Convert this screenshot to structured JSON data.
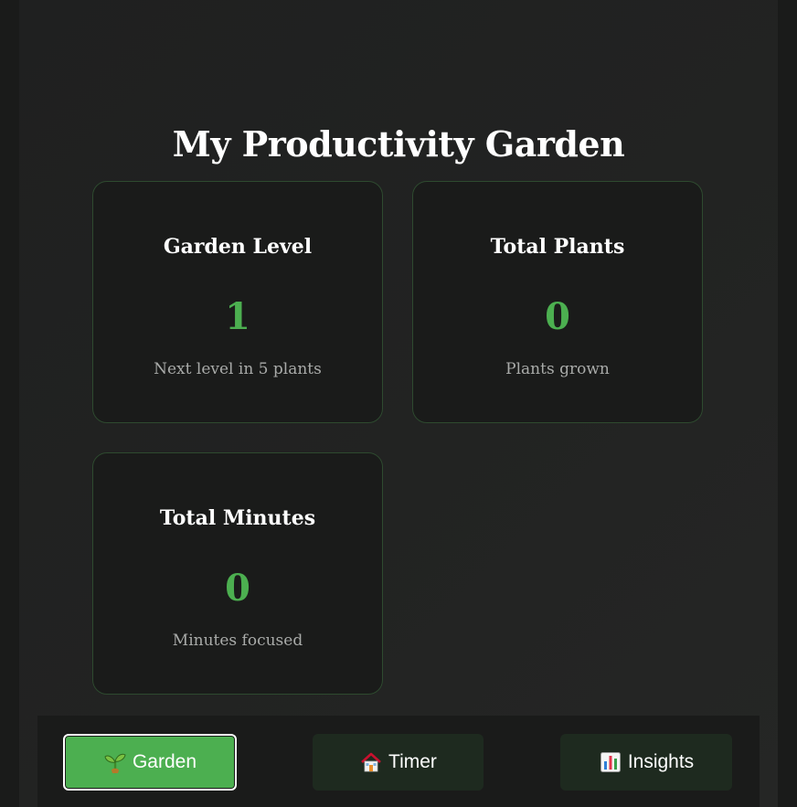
{
  "page": {
    "title": "My Productivity Garden"
  },
  "stats": [
    {
      "title": "Garden Level",
      "value": "1",
      "subtitle": "Next level in 5 plants"
    },
    {
      "title": "Total Plants",
      "value": "0",
      "subtitle": "Plants grown"
    },
    {
      "title": "Total Minutes",
      "value": "0",
      "subtitle": "Minutes focused"
    }
  ],
  "nav": {
    "active": "Garden",
    "items": [
      {
        "label": "Garden",
        "icon": "seedling-icon"
      },
      {
        "label": "Timer",
        "icon": "house-icon"
      },
      {
        "label": "Insights",
        "icon": "bar-chart-icon"
      }
    ]
  },
  "colors": {
    "accent": "#4caf50",
    "background": "#1f2020",
    "card_border": "#2e4a2f",
    "nav_button": "#1e2a1f"
  }
}
